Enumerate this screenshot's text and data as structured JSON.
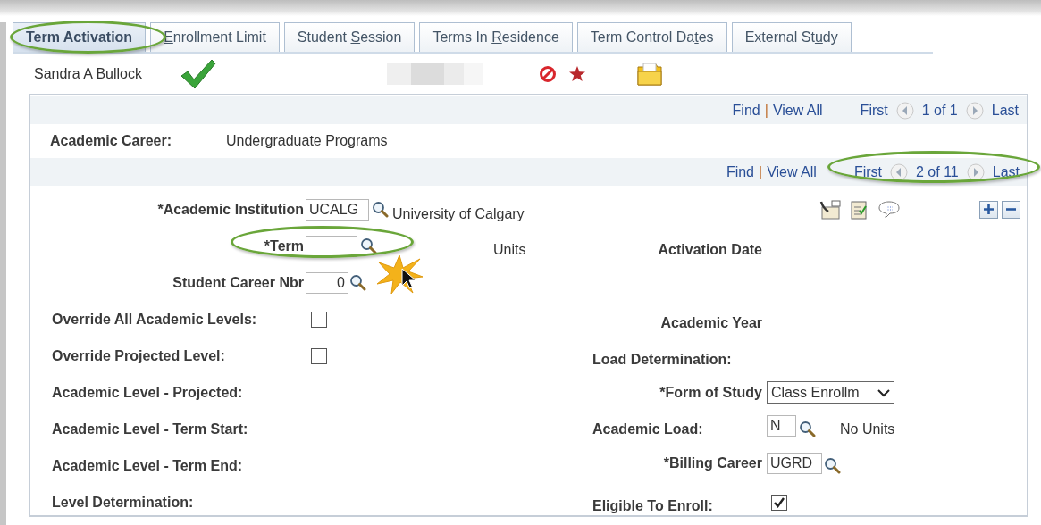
{
  "tabs": [
    {
      "text_before": "Term Activation",
      "selected": true
    },
    {
      "access_key": "E",
      "text_after": "nrollment Limit",
      "selected": false
    },
    {
      "text_before": "Student ",
      "access_key": "S",
      "text_after": "ession",
      "selected": false
    },
    {
      "text_before": "Terms In ",
      "access_key": "R",
      "text_after": "esidence",
      "selected": false
    },
    {
      "text_before": "Term Control Da",
      "access_key": "t",
      "text_after": "es",
      "selected": false
    },
    {
      "text_before": "External St",
      "access_key": "u",
      "text_after": "dy",
      "selected": false
    }
  ],
  "header": {
    "student_name": "Sandra A Bullock"
  },
  "outer_nav": {
    "find": "Find",
    "separator": "|",
    "view_all": "View All",
    "first": "First",
    "count": "1 of 1",
    "last": "Last"
  },
  "academic_career": {
    "label": "Academic Career:",
    "value": "Undergraduate Programs"
  },
  "inner_nav": {
    "find": "Find",
    "separator": "|",
    "view_all": "View All",
    "first": "First",
    "count": "2 of 11",
    "last": "Last"
  },
  "form": {
    "institution": {
      "label": "*Academic Institution",
      "value": "UCALG",
      "description": "University of Calgary"
    },
    "term": {
      "label": "*Term"
    },
    "units_heading": "Units",
    "activation_date_heading": "Activation Date",
    "student_career_nbr": {
      "label": "Student Career Nbr",
      "value": "0"
    },
    "override_all": {
      "label": "Override All Academic Levels:",
      "checked": false
    },
    "academic_year_heading": "Academic Year",
    "override_projected": {
      "label": "Override Projected Level:",
      "checked": false
    },
    "load_determination": "Load Determination:",
    "level_projected": "Academic Level - Projected:",
    "form_of_study": {
      "label": "*Form of Study",
      "value": "Class Enrollm"
    },
    "level_term_start": "Academic Level - Term Start:",
    "academic_load": {
      "label": "Academic Load:",
      "value": "N",
      "description": "No Units"
    },
    "level_term_end": "Academic Level - Term End:",
    "billing_career": {
      "label": "*Billing Career",
      "value": "UGRD"
    },
    "level_determination": "Level Determination:",
    "eligible": {
      "label": "Eligible To Enroll:",
      "checked": true
    }
  }
}
